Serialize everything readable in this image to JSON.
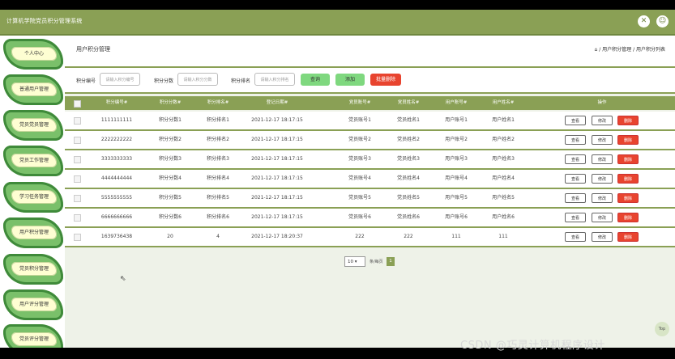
{
  "app": {
    "title": "计算机学院党员积分管理系统"
  },
  "sidebar": {
    "items": [
      {
        "label": "个人中心"
      },
      {
        "label": "普通用户管理"
      },
      {
        "label": "党员党员管理"
      },
      {
        "label": "党员工作管理"
      },
      {
        "label": "学习任务管理"
      },
      {
        "label": "用户积分管理"
      },
      {
        "label": "党员积分管理"
      },
      {
        "label": "用户评分管理"
      },
      {
        "label": "党员评分管理"
      }
    ]
  },
  "page": {
    "title": "用户积分管理",
    "breadcrumb": "⌂ / 用户积分管理 / 用户积分列表"
  },
  "search": {
    "fields": [
      {
        "label": "积分编号",
        "placeholder": "请输入积分编号"
      },
      {
        "label": "积分分数",
        "placeholder": "请输入积分分数"
      },
      {
        "label": "积分排名",
        "placeholder": "请输入积分排名"
      }
    ],
    "query_label": "查询",
    "add_label": "添加",
    "batch_delete_label": "批量删除"
  },
  "table": {
    "headers": [
      "积分编号#",
      "积分分数#",
      "积分排名#",
      "登记日期#",
      "党员账号#",
      "党员姓名#",
      "用户账号#",
      "用户姓名#",
      "操作"
    ],
    "rows": [
      [
        "1111111111",
        "积分分数1",
        "积分排名1",
        "2021-12-17 18:17:15",
        "党员账号1",
        "党员姓名1",
        "用户账号1",
        "用户姓名1"
      ],
      [
        "2222222222",
        "积分分数2",
        "积分排名2",
        "2021-12-17 18:17:15",
        "党员账号2",
        "党员姓名2",
        "用户账号2",
        "用户姓名2"
      ],
      [
        "3333333333",
        "积分分数3",
        "积分排名3",
        "2021-12-17 18:17:15",
        "党员账号3",
        "党员姓名3",
        "用户账号3",
        "用户姓名3"
      ],
      [
        "4444444444",
        "积分分数4",
        "积分排名4",
        "2021-12-17 18:17:15",
        "党员账号4",
        "党员姓名4",
        "用户账号4",
        "用户姓名4"
      ],
      [
        "5555555555",
        "积分分数5",
        "积分排名5",
        "2021-12-17 18:17:15",
        "党员账号5",
        "党员姓名5",
        "用户账号5",
        "用户姓名5"
      ],
      [
        "6666666666",
        "积分分数6",
        "积分排名6",
        "2021-12-17 18:17:15",
        "党员账号6",
        "党员姓名6",
        "用户账号6",
        "用户姓名6"
      ],
      [
        "1639736438",
        "20",
        "4",
        "2021-12-17 18:20:37",
        "222",
        "222",
        "111",
        "111"
      ]
    ],
    "actions": {
      "view": "查看",
      "edit": "修改",
      "delete": "删除"
    }
  },
  "pagination": {
    "page_size": "10",
    "size_label": "条/每页",
    "current_page": "1"
  },
  "misc": {
    "top_label": "Top",
    "watermark": "CSDN @巧灵计算机程序设计"
  },
  "colors": {
    "header": "#8aa055",
    "leaf": "#7ac06a",
    "danger": "#e8442f",
    "add": "#7fd87f"
  }
}
